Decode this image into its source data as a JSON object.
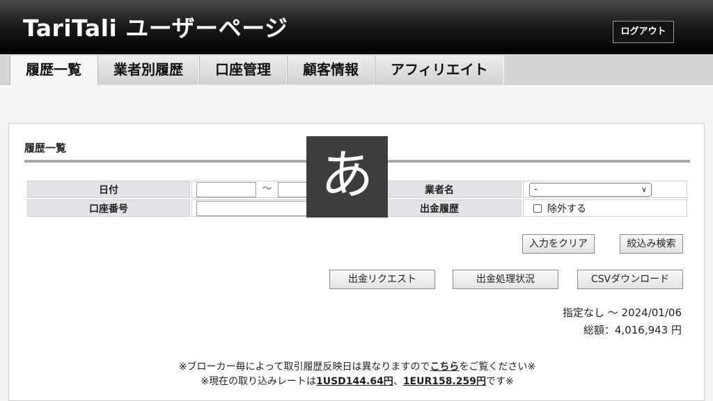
{
  "header": {
    "title": "TariTali ユーザーページ",
    "logout_label": "ログアウト"
  },
  "nav": {
    "tabs": [
      {
        "label": "履歴一覧",
        "active": true
      },
      {
        "label": "業者別履歴"
      },
      {
        "label": "口座管理"
      },
      {
        "label": "顧客情報"
      },
      {
        "label": "アフィリエイト"
      }
    ]
  },
  "panel": {
    "title": "履歴一覧",
    "filters": {
      "date_label": "日付",
      "date_from": "",
      "date_sep": "～",
      "date_to": "",
      "broker_label": "業者名",
      "broker_value": "-",
      "account_label": "口座番号",
      "account_value": "",
      "withdraw_label": "出金履歴",
      "exclude_label": "除外する"
    },
    "buttons": {
      "clear": "入力をクリア",
      "search": "絞込み検索",
      "withdraw_request": "出金リクエスト",
      "withdraw_status": "出金処理状況",
      "csv": "CSVダウンロード"
    },
    "totals": {
      "range": "指定なし ～ 2024/01/06",
      "total": "総額：4,016,943 円"
    },
    "notes": {
      "line1_a": "※ブローカー毎によって取引履歴反映日は異なりますので",
      "line1_link": "こちら",
      "line1_b": "をご覧ください※",
      "line2_a": "※現在の取り込みレートは",
      "line2_usd": "1USD144.64円",
      "line2_sep": "、",
      "line2_eur": "1EUR158.259円",
      "line2_b": "です※"
    }
  },
  "ime": {
    "char": "あ"
  }
}
